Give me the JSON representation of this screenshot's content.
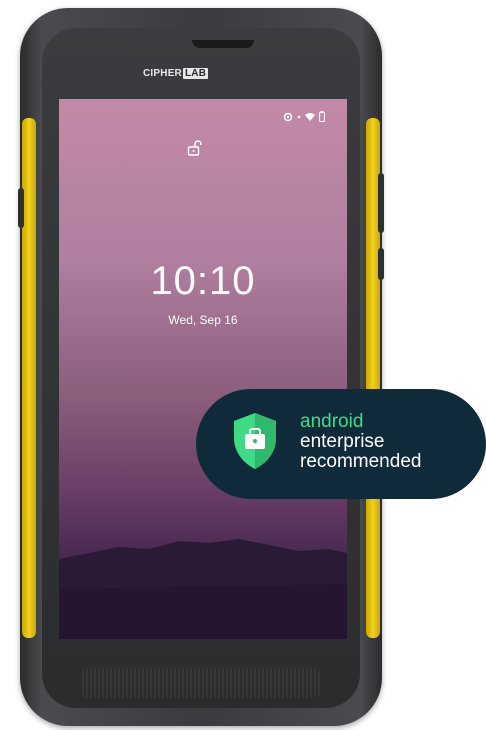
{
  "device": {
    "brand_main": "CIPHER",
    "brand_box": "LAB"
  },
  "lockscreen": {
    "time": "10:10",
    "date": "Wed, Sep 16",
    "status_icons": [
      "data-saver-icon",
      "dot-icon",
      "wifi-icon",
      "battery-icon"
    ],
    "lock_icon": "unlock-icon"
  },
  "badge": {
    "line1": "android",
    "line2": "enterprise",
    "line3": "recommended",
    "icon": "shield-briefcase-icon",
    "colors": {
      "background": "#0f2b3a",
      "accent": "#3ddc84",
      "text": "#ffffff"
    }
  },
  "colors": {
    "device_body": "#3a3b3e",
    "side_trim": "#f2d21b"
  }
}
